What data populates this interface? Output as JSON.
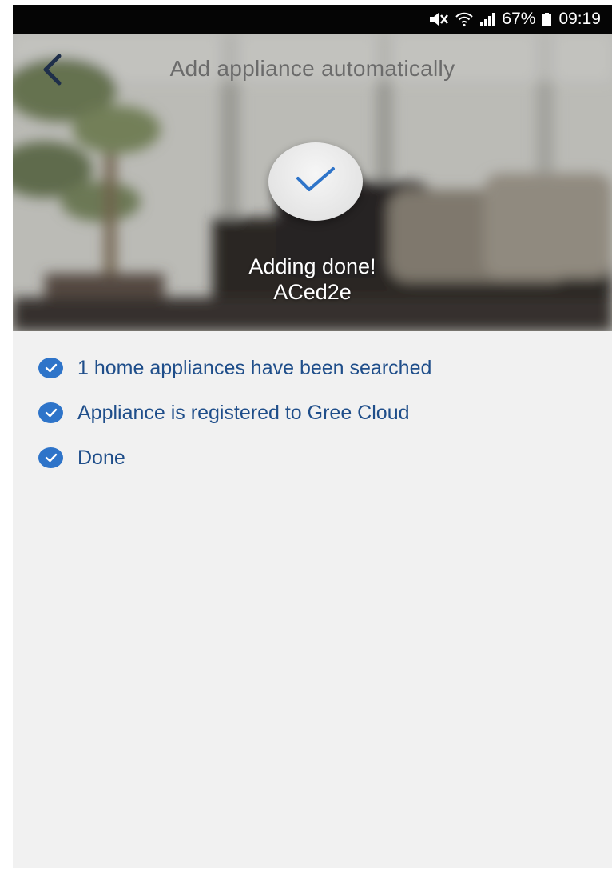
{
  "status_bar": {
    "battery_percent": "67%",
    "time": "09:19",
    "icons": [
      "mute-icon",
      "wifi-icon",
      "signal-icon",
      "battery-icon"
    ]
  },
  "header": {
    "title": "Add appliance automatically",
    "back_icon": "chevron-left-icon"
  },
  "result": {
    "message": "Adding done!",
    "device_name": "ACed2e",
    "icon": "check-icon"
  },
  "steps": [
    {
      "label": "1 home appliances have been searched",
      "icon": "check-circle-icon"
    },
    {
      "label": "Appliance is registered to Gree Cloud",
      "icon": "check-circle-icon"
    },
    {
      "label": "Done",
      "icon": "check-circle-icon"
    }
  ],
  "colors": {
    "accent": "#2e74c9",
    "step_text": "#1f4e8a",
    "status_bar": "#050505",
    "background": "#f1f1f1"
  }
}
